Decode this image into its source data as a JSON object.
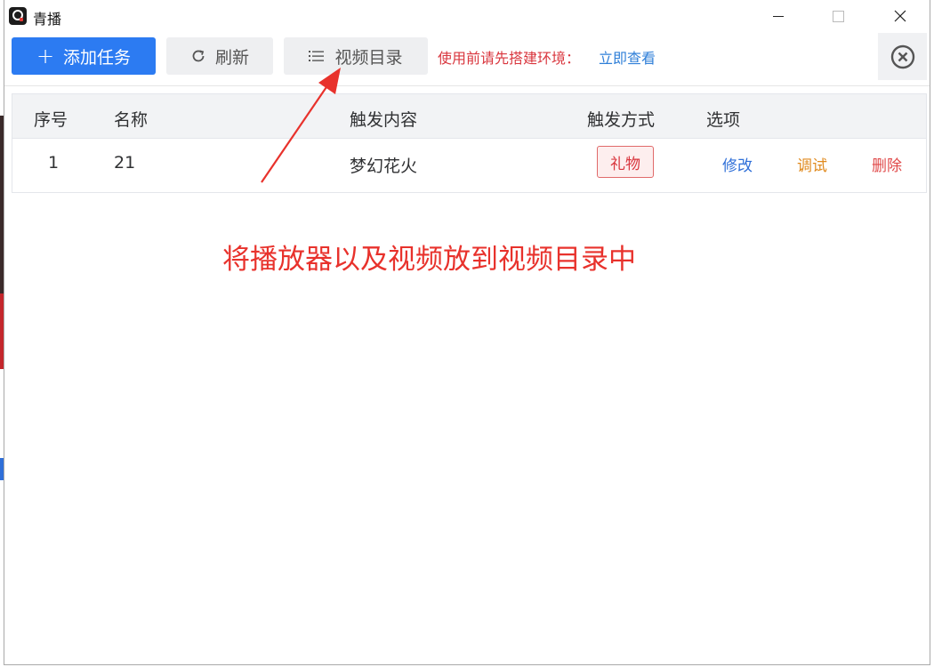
{
  "window": {
    "title": "青播",
    "minimize_icon": "minimize-icon",
    "maximize_icon": "maximize-icon",
    "close_icon": "close-icon"
  },
  "toolbar": {
    "add_label": "添加任务",
    "refresh_label": "刷新",
    "directory_label": "视频目录",
    "notice_text": "使用前请先搭建环境：",
    "notice_link": "立即查看",
    "accent_color": "#2c7bf2",
    "notice_color": "#d9363e"
  },
  "table": {
    "columns": [
      "序号",
      "名称",
      "触发内容",
      "触发方式",
      "选项"
    ],
    "rows": [
      {
        "index": "1",
        "name": "21",
        "content": "梦幻花火",
        "trigger": "礼物",
        "actions": [
          "修改",
          "调试",
          "删除"
        ]
      }
    ]
  },
  "annotation": {
    "text": "将播放器以及视频放到视频目录中",
    "color": "#e8322c"
  }
}
